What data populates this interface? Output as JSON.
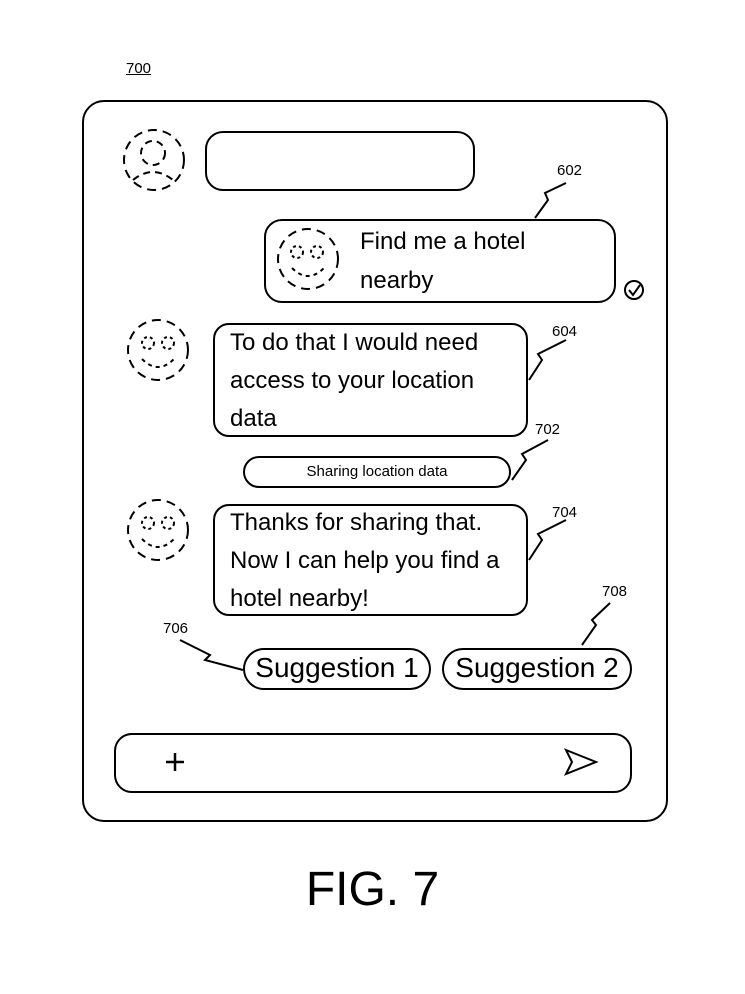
{
  "figure_ref": "700",
  "figure_label": "FIG. 7",
  "messages": {
    "user_request": {
      "ref": "602",
      "text_line1": "Find me a hotel",
      "text_line2": "nearby"
    },
    "bot_reply_1": {
      "ref": "604",
      "text_line1": "To do that I would need",
      "text_line2": "access to your location",
      "text_line3": "data"
    },
    "system_notice": {
      "ref": "702",
      "text": "Sharing location data"
    },
    "bot_reply_2": {
      "ref": "704",
      "text_line1": "Thanks for sharing that.",
      "text_line2": "Now I can help you find a",
      "text_line3": "hotel nearby!"
    }
  },
  "suggestions": [
    {
      "ref": "706",
      "label": "Suggestion 1"
    },
    {
      "ref": "708",
      "label": "Suggestion 2"
    }
  ],
  "composer": {
    "add_icon": "plus-icon",
    "send_icon": "send-icon"
  },
  "icons": {
    "contact": "user-avatar-icon",
    "bot": "smiley-face-icon",
    "delivered": "check-circle-icon"
  }
}
